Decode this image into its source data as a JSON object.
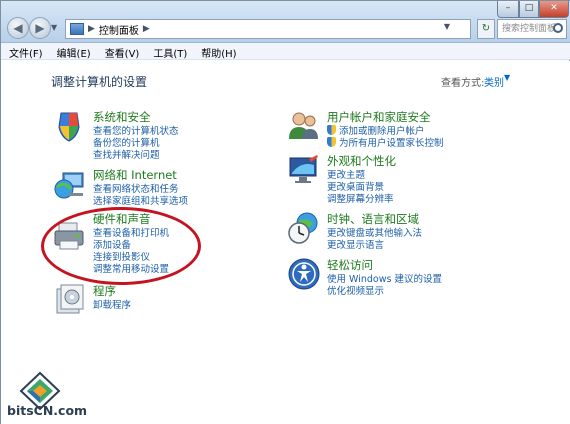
{
  "window": {
    "breadcrumb": "控制面板",
    "search_placeholder": "搜索控制面板",
    "controls": {
      "minimize": "–",
      "maximize": "□",
      "close": "✕"
    }
  },
  "menu": [
    {
      "label": "文件(F)"
    },
    {
      "label": "编辑(E)"
    },
    {
      "label": "查看(V)"
    },
    {
      "label": "工具(T)"
    },
    {
      "label": "帮助(H)"
    }
  ],
  "page": {
    "title": "调整计算机的设置",
    "view_by_label": "查看方式:",
    "view_by_value": "类别"
  },
  "categories_left": [
    {
      "title": "系统和安全",
      "icon": "shield-flag-icon",
      "links": [
        "查看您的计算机状态",
        "备份您的计算机",
        "查找并解决问题"
      ]
    },
    {
      "title": "网络和 Internet",
      "icon": "globe-network-icon",
      "links": [
        "查看网络状态和任务",
        "选择家庭组和共享选项"
      ]
    },
    {
      "title": "硬件和声音",
      "icon": "printer-icon",
      "links": [
        "查看设备和打印机",
        "添加设备",
        "连接到投影仪",
        "调整常用移动设置"
      ]
    },
    {
      "title": "程序",
      "icon": "programs-icon",
      "links": [
        "卸载程序"
      ]
    }
  ],
  "categories_right": [
    {
      "title": "用户帐户和家庭安全",
      "icon": "users-icon",
      "links": [
        "添加或删除用户帐户",
        "为所有用户设置家长控制"
      ]
    },
    {
      "title": "外观和个性化",
      "icon": "monitor-icon",
      "links": [
        "更改主题",
        "更改桌面背景",
        "调整屏幕分辨率"
      ]
    },
    {
      "title": "时钟、语言和区域",
      "icon": "clock-globe-icon",
      "links": [
        "更改键盘或其他输入法",
        "更改显示语言"
      ]
    },
    {
      "title": "轻松访问",
      "icon": "accessibility-icon",
      "links": [
        "使用 Windows 建议的设置",
        "优化视频显示"
      ]
    }
  ],
  "watermark": {
    "text": "bitsCN.com"
  },
  "colors": {
    "category_title": "#1e7a1e",
    "link": "#1d5fa8",
    "annotation": "#c41420"
  }
}
